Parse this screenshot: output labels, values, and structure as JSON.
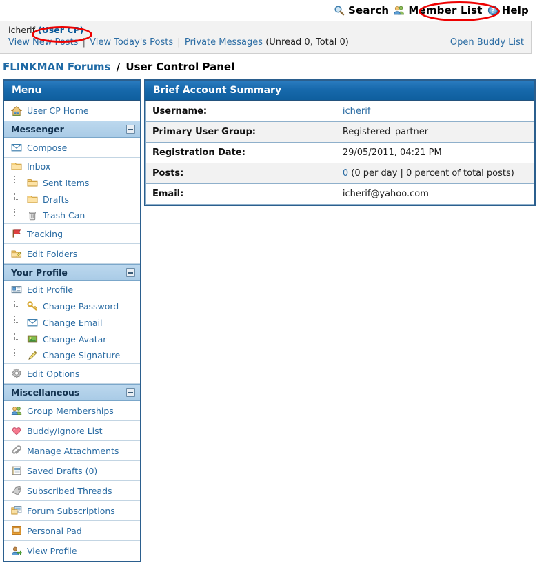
{
  "topbar": {
    "items": [
      {
        "icon": "search-icon",
        "label": "Search"
      },
      {
        "icon": "members-icon",
        "label": "Member List"
      },
      {
        "icon": "help-icon",
        "label": "Help"
      }
    ]
  },
  "userstrip": {
    "username": "icherif",
    "usercp_label": "(User CP)",
    "links": [
      {
        "label": "View New Posts"
      },
      {
        "label": "View Today's Posts"
      },
      {
        "label": "Private Messages"
      }
    ],
    "pm_counts": "(Unread 0, Total 0)",
    "buddy_list": "Open Buddy List",
    "separator": "|"
  },
  "breadcrumb": {
    "root": "FLINKMAN Forums",
    "separator": "/",
    "current": "User Control Panel"
  },
  "sidebar": {
    "title": "Menu",
    "home": {
      "icon": "home-icon",
      "label": "User CP Home"
    },
    "sections": [
      {
        "title": "Messenger",
        "collapse": "collapse-icon",
        "items": [
          {
            "icon": "envelope-icon",
            "label": "Compose",
            "indent": false,
            "standalone": true
          },
          {
            "icon": "folder-icon",
            "label": "Inbox",
            "indent": false,
            "standalone": false
          },
          {
            "icon": "folder-icon",
            "label": "Sent Items",
            "indent": true,
            "standalone": false
          },
          {
            "icon": "folder-icon",
            "label": "Drafts",
            "indent": true,
            "standalone": false
          },
          {
            "icon": "trash-icon",
            "label": "Trash Can",
            "indent": true,
            "standalone": false
          }
        ]
      }
    ],
    "messenger_extra": [
      {
        "icon": "tracking-icon",
        "label": "Tracking"
      },
      {
        "icon": "edit-folders-icon",
        "label": "Edit Folders"
      }
    ],
    "profile_section": {
      "title": "Your Profile",
      "collapse": "collapse-icon",
      "items": [
        {
          "icon": "profile-card-icon",
          "label": "Edit Profile",
          "indent": false
        },
        {
          "icon": "key-icon",
          "label": "Change Password",
          "indent": true
        },
        {
          "icon": "envelope-icon",
          "label": "Change Email",
          "indent": true
        },
        {
          "icon": "avatar-image-icon",
          "label": "Change Avatar",
          "indent": true
        },
        {
          "icon": "pencil-icon",
          "label": "Change Signature",
          "indent": true
        }
      ],
      "extra": [
        {
          "icon": "gear-icon",
          "label": "Edit Options"
        }
      ]
    },
    "misc_section": {
      "title": "Miscellaneous",
      "collapse": "collapse-icon",
      "items": [
        {
          "icon": "group-users-icon",
          "label": "Group Memberships"
        },
        {
          "icon": "heart-icon",
          "label": "Buddy/Ignore List"
        },
        {
          "icon": "paperclip-icon",
          "label": "Manage Attachments"
        },
        {
          "icon": "notebook-icon",
          "label": "Saved Drafts (0)"
        },
        {
          "icon": "tag-icon",
          "label": "Subscribed Threads"
        },
        {
          "icon": "folder-window-icon",
          "label": "Forum Subscriptions"
        },
        {
          "icon": "pad-icon",
          "label": "Personal Pad"
        },
        {
          "icon": "user-arrow-icon",
          "label": "View Profile"
        }
      ]
    }
  },
  "main": {
    "title": "Brief Account Summary",
    "rows": [
      {
        "label": "Username:",
        "value": "icherif",
        "link": true
      },
      {
        "label": "Primary User Group:",
        "value": "Registered_partner",
        "link": false
      },
      {
        "label": "Registration Date:",
        "value": "29/05/2011, 04:21 PM",
        "link": false
      },
      {
        "label": "Posts:",
        "value_link": "0",
        "value_rest": " (0 per day | 0 percent of total posts)",
        "link": true
      },
      {
        "label": "Email:",
        "value": "icherif@yahoo.com",
        "link": false
      }
    ]
  },
  "annotations": [
    {
      "name": "member-list-highlight",
      "color": "#ee0000"
    },
    {
      "name": "user-cp-highlight",
      "color": "#ee0000"
    }
  ]
}
